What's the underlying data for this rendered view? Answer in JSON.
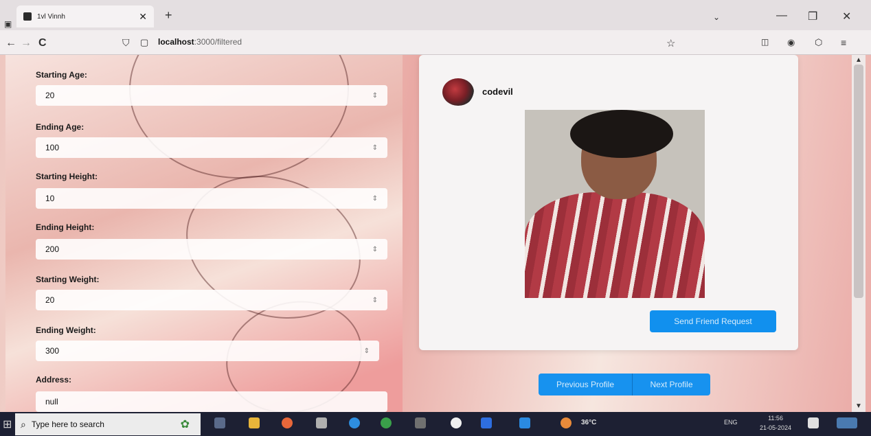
{
  "browser": {
    "tab_title": "1vl Vinnh",
    "tab_close": "✕",
    "new_tab": "+",
    "url_host": "localhost",
    "url_path": ":3000/filtered",
    "back": "←",
    "forward": "→",
    "reload": "C",
    "minimize": "—",
    "restore": "❐",
    "close": "✕",
    "tab_list": "⌄"
  },
  "filters": [
    {
      "label": "Starting Age:",
      "value": "20"
    },
    {
      "label": "Ending Age:",
      "value": "100"
    },
    {
      "label": "Starting Height:",
      "value": "10"
    },
    {
      "label": "Ending Height:",
      "value": "200"
    },
    {
      "label": "Starting Weight:",
      "value": "20"
    },
    {
      "label": "Ending Weight:",
      "value": "300"
    },
    {
      "label": "Address:",
      "value": "null"
    }
  ],
  "profile": {
    "username": "codevil",
    "send_request_label": "Send Friend Request"
  },
  "pagination": {
    "previous_label": "Previous Profile",
    "next_label": "Next Profile"
  },
  "taskbar": {
    "search_placeholder": "Type here to search",
    "temperature": "36°C",
    "language": "ENG",
    "time": "11:56",
    "date": "21-05-2024"
  },
  "icons": {
    "start": "⊞",
    "search": "⌕",
    "spin": "⇕",
    "shield": "⛉",
    "page": "▢",
    "star": "☆",
    "scroll_up": "▲",
    "scroll_down": "▼"
  }
}
